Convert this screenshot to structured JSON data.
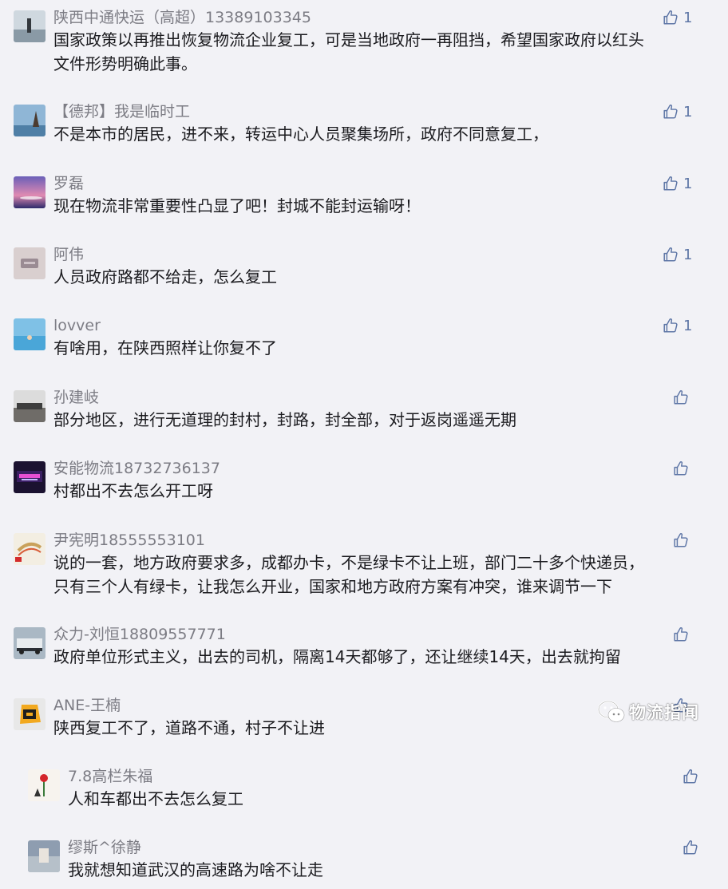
{
  "comments": [
    {
      "name": "陕西中通快运（高超）13389103345",
      "lines": [
        "国家政策以再推出恢复物流企业复工，可是当地政府一再阻挡，希望国家政府以红头",
        "文件形势明确此事。"
      ],
      "likes": "1"
    },
    {
      "name": "【德邦】我是临时工",
      "lines": [
        "不是本市的居民，进不来，转运中心人员聚集场所，政府不同意复工，"
      ],
      "likes": "1"
    },
    {
      "name": "罗磊",
      "lines": [
        "现在物流非常重要性凸显了吧！封城不能封运输呀！"
      ],
      "likes": "1"
    },
    {
      "name": "阿伟",
      "lines": [
        "人员政府路都不给走，怎么复工"
      ],
      "likes": "1"
    },
    {
      "name": "lovver",
      "lines": [
        "有啥用，在陕西照样让你复不了"
      ],
      "likes": "1"
    },
    {
      "name": "孙建岐",
      "lines": [
        "部分地区，进行无道理的封村，封路，封全部，对于返岗遥遥无期"
      ],
      "likes": ""
    },
    {
      "name": "安能物流18732736137",
      "lines": [
        "村都出不去怎么开工呀"
      ],
      "likes": ""
    },
    {
      "name": "尹宪明18555553101",
      "lines": [
        "说的一套，地方政府要求多，成都办卡，不是绿卡不让上班，部门二十多个快递员，",
        "只有三个人有绿卡，让我怎么开业，国家和地方政府方案有冲突，谁来调节一下"
      ],
      "likes": ""
    },
    {
      "name": "众力-刘恒18809557771",
      "lines": [
        "政府单位形式主义，出去的司机，隔离14天都够了，还让继续14天，出去就拘留"
      ],
      "likes": ""
    },
    {
      "name": "ANE-王楠",
      "lines": [
        "陕西复工不了，道路不通，村子不让进"
      ],
      "likes": ""
    },
    {
      "name": "7.8高栏朱福",
      "lines": [
        "人和车都出不去怎么复工"
      ],
      "likes": ""
    },
    {
      "name": "缪斯^徐静",
      "lines": [
        "我就想知道武汉的高速路为啥不让走"
      ],
      "likes": ""
    }
  ],
  "watermark": {
    "text": "物流指闻",
    "icon": "wechat-icon"
  },
  "colors": {
    "background": "#f2f2f6",
    "name": "#7c7c84",
    "text": "#1b1b1f",
    "like": "#5e76a6"
  }
}
